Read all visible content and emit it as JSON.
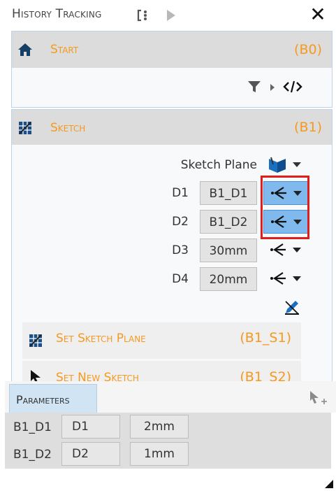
{
  "header": {
    "title": "History Tracking",
    "icons": [
      "refresh-cycle-icon",
      "play-icon",
      "close-icon"
    ]
  },
  "start_panel": {
    "name": "Start",
    "code": "(B0)",
    "icon": "home-icon",
    "toolbar_icons": [
      "filter-icon",
      "expand-arrow-icon",
      "code-icon"
    ]
  },
  "sketch_panel": {
    "name": "Sketch",
    "code": "(B1)",
    "icon": "sketch-grid-icon",
    "plane_label": "Sketch Plane",
    "rows": [
      {
        "label": "D1",
        "value": "B1_D1",
        "selected": true
      },
      {
        "label": "D2",
        "value": "B1_D2",
        "selected": true
      },
      {
        "label": "D3",
        "value": "30mm",
        "selected": false
      },
      {
        "label": "D4",
        "value": "20mm",
        "selected": false
      }
    ],
    "edit_icon": "edit-pen-icon",
    "sub_items": [
      {
        "name": "Set Sketch Plane",
        "code": "(B1_S1)",
        "icon": "sketch-grid-icon"
      },
      {
        "name": "Set New Sketch",
        "code": "(B1_S2)",
        "icon": "cursor-icon"
      }
    ]
  },
  "parameters": {
    "tab_label": "Parameters",
    "rows": [
      {
        "name": "B1_D1",
        "dim": "D1",
        "value": "2mm"
      },
      {
        "name": "B1_D2",
        "dim": "D2",
        "value": "1mm"
      }
    ]
  },
  "colors": {
    "accent": "#f59a1f",
    "selected": "#7fb9ee",
    "highlight": "#e21b1b",
    "header_bg": "#dcdcdc"
  }
}
